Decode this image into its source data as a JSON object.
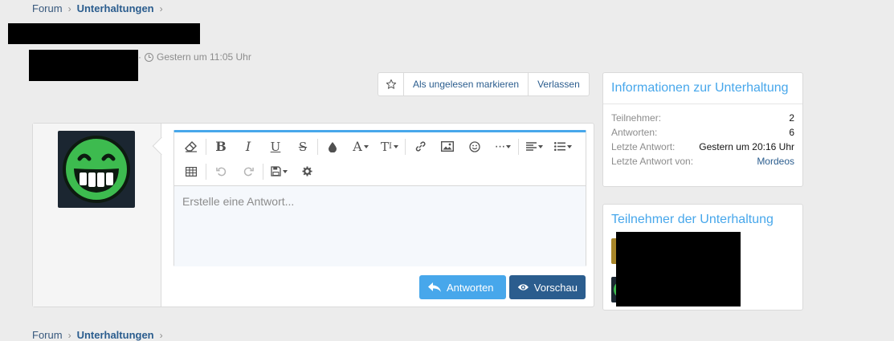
{
  "breadcrumb": {
    "items": [
      "Forum",
      "Unterhaltungen"
    ]
  },
  "meta": {
    "timestamp": "Gestern um 11:05 Uhr"
  },
  "thread_actions": {
    "star_icon": "star-icon",
    "mark_unread": "Als ungelesen markieren",
    "leave": "Verlassen"
  },
  "editor": {
    "placeholder": "Erstelle eine Antwort...",
    "reply_button": "Antworten",
    "preview_button": "Vorschau"
  },
  "info_block": {
    "title": "Informationen zur Unterhaltung",
    "rows": [
      {
        "label": "Teilnehmer:",
        "value": "2"
      },
      {
        "label": "Antworten:",
        "value": "6"
      },
      {
        "label": "Letzte Antwort:",
        "value": "Gestern um 20:16 Uhr"
      },
      {
        "label": "Letzte Antwort von:",
        "value": "Mordeos"
      }
    ]
  },
  "members_block": {
    "title": "Teilnehmer der Unterhaltung"
  },
  "colors": {
    "accent": "#47a7eb",
    "primary": "#2b5d8e",
    "avatar_green": "#3dbb4f"
  }
}
